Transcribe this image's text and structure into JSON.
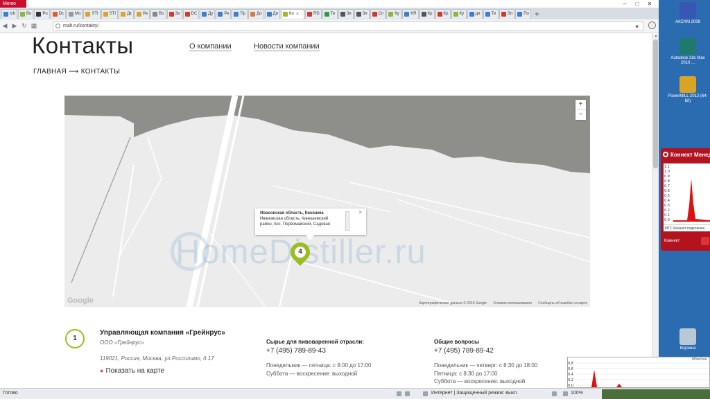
{
  "browser": {
    "menu_label": "Меню",
    "tabs": [
      {
        "label": "Izb",
        "color": "#3b7dd8"
      },
      {
        "label": "Bo",
        "color": "#8ab83a"
      },
      {
        "label": "Pu",
        "color": "#333333"
      },
      {
        "label": "Dc",
        "color": "#e05a2b"
      },
      {
        "label": "Mo",
        "color": "#999999"
      },
      {
        "label": "STI",
        "color": "#e0a030"
      },
      {
        "label": "STI",
        "color": "#e0a030"
      },
      {
        "label": "Дк",
        "color": "#e0a030"
      },
      {
        "label": "Ре",
        "color": "#e0a030"
      },
      {
        "label": "Во",
        "color": "#888888"
      },
      {
        "label": "Зи",
        "color": "#d33a2c"
      },
      {
        "label": "DC",
        "color": "#d33a2c"
      },
      {
        "label": "Ду",
        "color": "#3b7dd8"
      },
      {
        "label": "Ре",
        "color": "#3b7dd8"
      },
      {
        "label": "Пр",
        "color": "#3b7dd8"
      },
      {
        "label": "До",
        "color": "#e07a3a"
      },
      {
        "label": "Ди",
        "color": "#3b7dd8"
      }
    ],
    "active_tab": {
      "label": "Ко",
      "color": "#9cbd1f"
    },
    "tabs_after": [
      {
        "label": "RD",
        "color": "#d33a2c"
      },
      {
        "label": "Те",
        "color": "#2e9e3e"
      },
      {
        "label": "Зи",
        "color": "#555555"
      },
      {
        "label": "Зи",
        "color": "#555555"
      },
      {
        "label": "Сп",
        "color": "#d33a2c"
      },
      {
        "label": "Ку",
        "color": "#8ab83a"
      },
      {
        "label": "KR",
        "color": "#3b7dd8"
      },
      {
        "label": "Кр",
        "color": "#555555"
      },
      {
        "label": "Кр",
        "color": "#d33a2c"
      },
      {
        "label": "Ку",
        "color": "#8ab83a"
      },
      {
        "label": "ди",
        "color": "#3b7dd8"
      },
      {
        "label": "Те",
        "color": "#3b7dd8"
      },
      {
        "label": "Эл",
        "color": "#d33a2c"
      },
      {
        "label": "По",
        "color": "#3b7dd8"
      }
    ],
    "url": "malt.ru/kontakty/"
  },
  "page": {
    "title": "Контакты",
    "nav": [
      {
        "label": "О компании"
      },
      {
        "label": "Новости компании"
      }
    ],
    "breadcrumb": "ГЛАВНАЯ ⟶ КОНТАКТЫ"
  },
  "map": {
    "zoom_in": "+",
    "zoom_out": "−",
    "google_logo": "Google",
    "attribution": "Картографические данные © 2016 Google",
    "terms": "Условия использования",
    "report": "Сообщить об ошибке на карте",
    "watermark": "HomeDistiller.ru",
    "marker_number": "4",
    "popup": {
      "title": "Ивановская область, Кинешма",
      "line1": "Ивановская область, Кинешемский",
      "line2": "район, пос. Первомайский, Садовая",
      "close": "×"
    }
  },
  "contacts": {
    "badge": "1",
    "company_title": "Управляющая компания «Грейнрус»",
    "company_name": "ООО «Грейнрус»",
    "address": "119021, Россия, Москва, ул.Россолимо, д.17",
    "show_on_map": "Показать на карте",
    "columns": [
      {
        "heading": "Сырье для пивоваренной отрасли:",
        "phone": "+7 (495) 789-89-43",
        "hours1": "Понедельник — пятница: с 8:00 до 17:00",
        "hours2": "Суббота — воскресение: выходной"
      },
      {
        "heading": "Общие вопросы",
        "phone": "+7 (495) 789-89-42",
        "hours1": "Понедельник — четверг: с 8:30 до 18:00",
        "hours2": "Пятница: с 8:30 до 17:00",
        "hours3": "Суббота — воскресение: выходной"
      }
    ]
  },
  "statusbar": {
    "ready": "Готово",
    "zone": "Интернет | Защищенный режим: выкл.",
    "zoom": "100%"
  },
  "desktop": {
    "icons": [
      {
        "label": "ArtCAM 2008",
        "color": "#3a56b5"
      },
      {
        "label": "Autodesk 3ds Max 2010 ...",
        "color": "#1f7a6e"
      },
      {
        "label": "PowerMILL 2012 (64-bit)",
        "color": "#d9a425"
      },
      {
        "label": "Корзина",
        "color": "#b9c7d6"
      }
    ],
    "konnekt": {
      "title": "Коннект Менеджер",
      "status": "МТС Коннект подключен",
      "button": "Коннект",
      "axis": [
        "1.1",
        "1.0",
        "0.9",
        "0.8",
        "0.7",
        "0.6",
        "0.5",
        "0.4",
        "0.3",
        "0.2",
        "0.1",
        "0.0"
      ]
    },
    "mini_graph": {
      "units": "Мбит/сек",
      "axis": [
        "0.8",
        "0.6",
        "0.4",
        "0.2",
        "0.0"
      ]
    }
  }
}
